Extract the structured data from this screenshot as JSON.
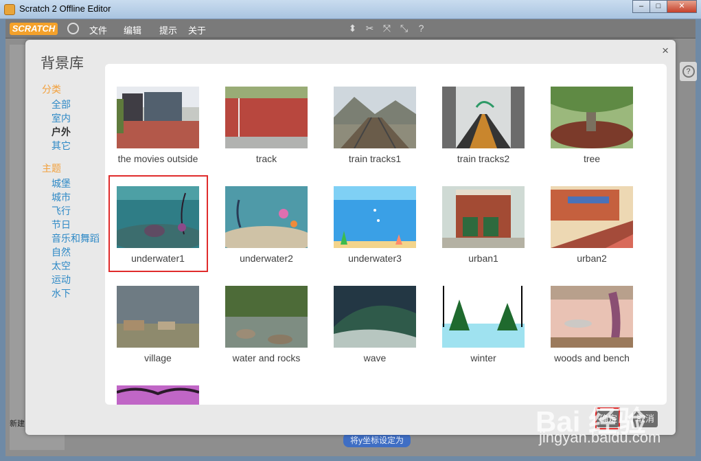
{
  "window": {
    "title": "Scratch 2 Offline Editor"
  },
  "menubar": {
    "brand": "SCRATCH",
    "items": [
      "文件",
      "编辑",
      "提示",
      "关于"
    ]
  },
  "dialog": {
    "title": "背景库",
    "close": "×",
    "categories_heading": "分类",
    "categories": [
      "全部",
      "室内",
      "户外",
      "其它"
    ],
    "selected_category": "户外",
    "themes_heading": "主题",
    "themes": [
      "城堡",
      "城市",
      "飞行",
      "节日",
      "音乐和舞蹈",
      "自然",
      "太空",
      "运动",
      "水下"
    ]
  },
  "library": {
    "items": [
      {
        "label": "the movies outside"
      },
      {
        "label": "track"
      },
      {
        "label": "train tracks1"
      },
      {
        "label": "train tracks2"
      },
      {
        "label": "tree"
      },
      {
        "label": "underwater1",
        "selected": true
      },
      {
        "label": "underwater2"
      },
      {
        "label": "underwater3"
      },
      {
        "label": "urban1"
      },
      {
        "label": "urban2"
      },
      {
        "label": "village"
      },
      {
        "label": "water and rocks"
      },
      {
        "label": "wave"
      },
      {
        "label": "winter"
      },
      {
        "label": "woods and bench"
      },
      {
        "label": ""
      }
    ]
  },
  "footer": {
    "ok": "确定",
    "cancel": "取消"
  },
  "editor": {
    "new_label": "新建",
    "block_text": "将y坐标设定为"
  },
  "watermark": {
    "main": "Bai 经验",
    "sub": "jingyan.baidu.com"
  }
}
